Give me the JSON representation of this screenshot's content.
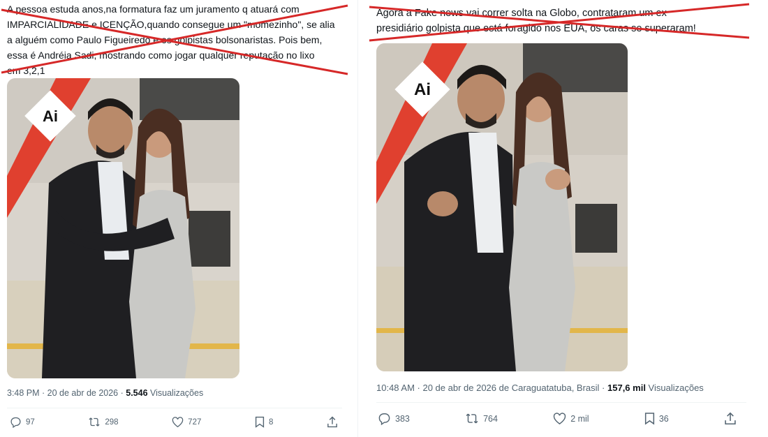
{
  "left_tweet": {
    "text": "A pessoa estuda anos,na formatura faz um juramento q atuará com\nIMPARCIALIDADE e ICENÇÃO,quando consegue um \"momezinho\", se alia\na alguém como Paulo Figueiredo e os golpistas bolsonaristas. Pois bem,\nessa é Andréia Sadi, mostrando como jogar qualquer reputação no lixo\nem 3,2,1",
    "photo_badge": "Ai",
    "timestamp": "3:48 PM · 20 de abr de 2026 · ",
    "views_count": "5.546",
    "views_label": " Visualizações",
    "replies": "97",
    "reposts": "298",
    "likes": "727",
    "bookmarks": "8"
  },
  "right_tweet": {
    "text": "Agora a Fake news vai correr solta na Globo, contrataram um ex\npresidiário golpista que está foragido nos EUA, os caras se superaram!",
    "photo_badge": "Ai",
    "timestamp": "10:48 AM · 20 de abr de 2026 de Caraguatatuba, Brasil · ",
    "views_count": "157,6 mil",
    "views_label": " Visualizações",
    "replies": "383",
    "reposts": "764",
    "likes": "2 mil",
    "bookmarks": "36"
  },
  "icons": [
    "reply-icon",
    "repost-icon",
    "like-icon",
    "bookmark-icon",
    "share-icon"
  ],
  "colors": {
    "strike": "#d62828",
    "muted": "#536471",
    "text": "#0f1419",
    "badge_bg": "#ffffff",
    "stripe": "#e0402f"
  }
}
